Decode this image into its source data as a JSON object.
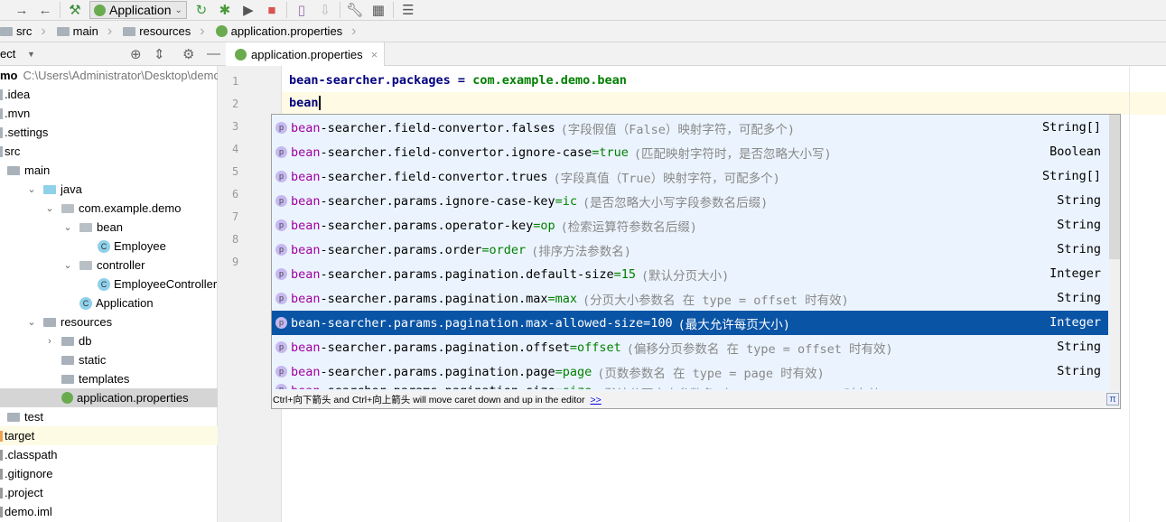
{
  "toolbar": {
    "run_config": "Application",
    "icons": [
      "forward-icon",
      "back-icon",
      "build-hammer-icon",
      "rerun-icon",
      "debug-icon",
      "run-coverage-icon",
      "stop-icon",
      "android-device-icon",
      "android-sdk-icon",
      "settings-wrench-icon",
      "project-structure-icon",
      "sdk-manager-icon"
    ]
  },
  "breadcrumb": [
    "src",
    "main",
    "resources",
    "application.properties"
  ],
  "project_panel": {
    "title": "ect",
    "root_name": "mo",
    "root_path": "C:\\Users\\Administrator\\Desktop\\demo",
    "items": [
      {
        "label": ".idea",
        "level": 0,
        "icon": "folder"
      },
      {
        "label": ".mvn",
        "level": 0,
        "icon": "folder"
      },
      {
        "label": ".settings",
        "level": 0,
        "icon": "folder"
      },
      {
        "label": "src",
        "level": 0,
        "icon": "folder"
      },
      {
        "label": "main",
        "level": 1,
        "icon": "folder"
      },
      {
        "label": "java",
        "level": 2,
        "icon": "folder-source",
        "expanded": true
      },
      {
        "label": "com.example.demo",
        "level": 3,
        "icon": "package",
        "expanded": true
      },
      {
        "label": "bean",
        "level": 4,
        "icon": "package",
        "expanded": true
      },
      {
        "label": "Employee",
        "level": 5,
        "icon": "class"
      },
      {
        "label": "controller",
        "level": 4,
        "icon": "package",
        "expanded": true
      },
      {
        "label": "EmployeeController",
        "level": 5,
        "icon": "class"
      },
      {
        "label": "Application",
        "level": 4,
        "icon": "spring-class"
      },
      {
        "label": "resources",
        "level": 2,
        "icon": "folder-resources",
        "expanded": true
      },
      {
        "label": "db",
        "level": 3,
        "icon": "folder",
        "collapsed": true
      },
      {
        "label": "static",
        "level": 3,
        "icon": "folder"
      },
      {
        "label": "templates",
        "level": 3,
        "icon": "folder"
      },
      {
        "label": "application.properties",
        "level": 3,
        "icon": "spring",
        "selected": true
      },
      {
        "label": "test",
        "level": 1,
        "icon": "folder"
      },
      {
        "label": "target",
        "level": 0,
        "icon": "folder-excluded",
        "highlight": true
      },
      {
        "label": ".classpath",
        "level": 0,
        "icon": "file"
      },
      {
        "label": ".gitignore",
        "level": 0,
        "icon": "file"
      },
      {
        "label": ".project",
        "level": 0,
        "icon": "file"
      },
      {
        "label": "demo.iml",
        "level": 0,
        "icon": "file"
      }
    ]
  },
  "editor": {
    "tab": "application.properties",
    "line_numbers": [
      "1",
      "2",
      "3",
      "4",
      "5",
      "6",
      "7",
      "8",
      "9"
    ],
    "line1": {
      "key": "bean-searcher.packages = ",
      "value": "com.example.demo.bean"
    },
    "line2": "bean"
  },
  "completion": {
    "match": "bean",
    "items": [
      {
        "rest": "-searcher.field-convertor.falses",
        "value": "",
        "desc": "(字段假值（False）映射字符，可配多个)",
        "type": "String[]"
      },
      {
        "rest": "-searcher.field-convertor.ignore-case",
        "value": "true",
        "desc": "(匹配映射字符时，是否忽略大小写)",
        "type": "Boolean"
      },
      {
        "rest": "-searcher.field-convertor.trues",
        "value": "",
        "desc": "(字段真值（True）映射字符，可配多个)",
        "type": "String[]"
      },
      {
        "rest": "-searcher.params.ignore-case-key",
        "value": "ic",
        "desc": "(是否忽略大小写字段参数名后缀)",
        "type": "String"
      },
      {
        "rest": "-searcher.params.operator-key",
        "value": "op",
        "desc": "(检索运算符参数名后缀)",
        "type": "String"
      },
      {
        "rest": "-searcher.params.order",
        "value": "order",
        "desc": "(排序方法参数名)",
        "type": "String"
      },
      {
        "rest": "-searcher.params.pagination.default-size",
        "value": "15",
        "desc": "(默认分页大小)",
        "type": "Integer"
      },
      {
        "rest": "-searcher.params.pagination.max",
        "value": "max",
        "desc": "(分页大小参数名 在 type = offset 时有效)",
        "type": "String"
      },
      {
        "rest": "-searcher.params.pagination.max-allowed-size",
        "value": "100",
        "desc": "(最大允许每页大小)",
        "type": "Integer",
        "selected": true
      },
      {
        "rest": "-searcher.params.pagination.offset",
        "value": "offset",
        "desc": "(偏移分页参数名 在 type = offset 时有效)",
        "type": "String"
      },
      {
        "rest": "-searcher.params.pagination.page",
        "value": "page",
        "desc": "(页数参数名 在 type = page 时有效)",
        "type": "String"
      },
      {
        "rest": "-searcher.params.pagination.size",
        "value": "size",
        "desc": "(默认分页大小参数名 在 type = offset 时有效)",
        "type": "String"
      }
    ],
    "footer": "Ctrl+向下箭头 and Ctrl+向上箭头 will move caret down and up in the editor",
    "footer_link": ">>",
    "pi": "π"
  },
  "colors": {
    "selection": "#0a54a6",
    "popup_bg": "#ebf4fe",
    "match": "#a000a0",
    "value": "#008000",
    "key": "#000080"
  }
}
